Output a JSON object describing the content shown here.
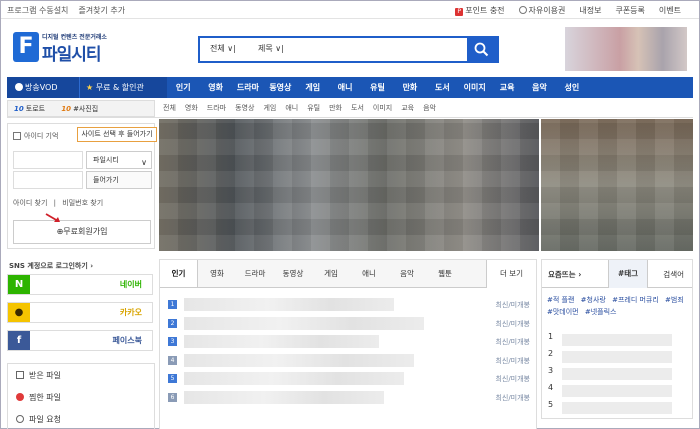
{
  "topbar": {
    "left": [
      "프로그램 수동설치",
      "즐겨찾기 추가"
    ],
    "right": [
      "포인트 충전",
      "자유이용권",
      "내정보",
      "쿠폰등록",
      "이벤트"
    ]
  },
  "logo": {
    "letter": "F",
    "subtitle": "디지털 컨텐츠 전문거래소",
    "name": "파일시티"
  },
  "search": {
    "scope": "전체",
    "field": "제목",
    "value": ""
  },
  "nav": {
    "vod": "방송VOD",
    "free": "무료 & 할인관",
    "items": [
      "인기",
      "영화",
      "드라마",
      "동영상",
      "게임",
      "애니",
      "유틸",
      "만화",
      "도서",
      "이미지",
      "교육",
      "음악",
      "성인"
    ]
  },
  "subrow": {
    "left": [
      {
        "num": "10",
        "label": "토로트"
      },
      {
        "num": "10",
        "label": "#사진집"
      }
    ],
    "cats": [
      "전체",
      "영화",
      "드라마",
      "동영상",
      "게임",
      "애니",
      "유틸",
      "만화",
      "도서",
      "이미지",
      "교육",
      "음악"
    ]
  },
  "login": {
    "remember": "아이디 기억",
    "tooltip": "사이트 선택 후 들어가기",
    "site_select": "파일시티",
    "enter": "들어가기",
    "find_id": "아이디 찾기",
    "find_pw": "비밀번호 찾기",
    "join": "⊕무료회원가입"
  },
  "sns": {
    "title": "SNS 계정으로 로그인하기",
    "items": [
      {
        "badge": "N",
        "label": "네이버",
        "color": "#2db400"
      },
      {
        "badge": "●",
        "label": "카카오",
        "color": "#f5c400"
      },
      {
        "badge": "f",
        "label": "페이스북",
        "color": "#3b5998"
      }
    ]
  },
  "mine": [
    "받은 파일",
    "찜한 파일",
    "파일 요청"
  ],
  "rank": {
    "tabs": [
      "인기",
      "영화",
      "드라마",
      "동영상",
      "게임",
      "애니",
      "음악",
      "웹툰"
    ],
    "more": "더 보기",
    "rows": [
      {
        "num": "1",
        "meta": "최신/미개봉"
      },
      {
        "num": "2",
        "meta": "최신/미개봉"
      },
      {
        "num": "3",
        "meta": "최신/미개봉"
      },
      {
        "num": "4",
        "meta": "최신/미개봉"
      },
      {
        "num": "5",
        "meta": "최신/미개봉"
      },
      {
        "num": "6",
        "meta": "최신/미개봉"
      }
    ]
  },
  "trend": {
    "title": "요즘뜨는",
    "tag_tab": "#태그",
    "search_tab": "검색어",
    "tags": [
      "#적 플랜",
      "#청사랑",
      "#프레디 머큐리",
      "#범죄",
      "#맛데이먼",
      "#넷플릭스"
    ],
    "ranks": [
      "1",
      "2",
      "3",
      "4",
      "5"
    ]
  }
}
